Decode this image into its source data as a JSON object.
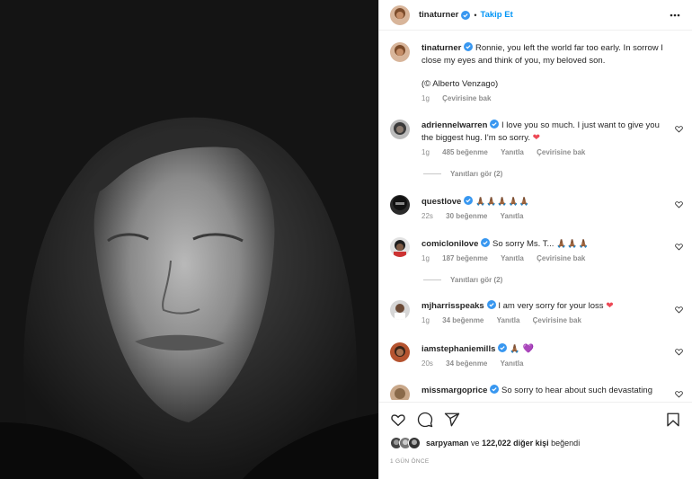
{
  "post": {
    "username": "tinaturner",
    "dot": "•",
    "follow_label": "Takip Et"
  },
  "caption": {
    "username": "tinaturner",
    "text": "Ronnie, you left the world far too early. In sorrow I close my eyes and think of you, my beloved son.",
    "credit": "(© Alberto Venzago)",
    "time": "1g",
    "translate": "Çevirisine bak"
  },
  "comments": [
    {
      "username": "adriennelwarren",
      "text": "I love you so much. I just want to give you the biggest hug. I'm so sorry.",
      "emoji": "❤",
      "time": "1g",
      "likes": "485 beğenme",
      "reply": "Yanıtla",
      "translate": "Çevirisine bak",
      "replies": "Yanıtları gör (2)"
    },
    {
      "username": "questlove",
      "text": "",
      "emoji": "🙏🏾🙏🏾🙏🏾🙏🏾🙏🏾",
      "time": "22s",
      "likes": "30 beğenme",
      "reply": "Yanıtla"
    },
    {
      "username": "comiclonilove",
      "text": "So sorry Ms. T...",
      "emoji": "🙏🏾🙏🏾🙏🏾",
      "time": "1g",
      "likes": "187 beğenme",
      "reply": "Yanıtla",
      "translate": "Çevirisine bak",
      "replies": "Yanıtları gör (2)"
    },
    {
      "username": "mjharrisspeaks",
      "text": "I am very sorry for your loss",
      "emoji": "❤",
      "time": "1g",
      "likes": "34 beğenme",
      "reply": "Yanıtla",
      "translate": "Çevirisine bak"
    },
    {
      "username": "iamstephaniemills",
      "text": "",
      "emoji": "🙏🏾",
      "emoji2": "💜",
      "time": "20s",
      "likes": "34 beğenme",
      "reply": "Yanıtla"
    },
    {
      "username": "missmargoprice",
      "text": "So sorry to hear about such devastating"
    }
  ],
  "likes_line": {
    "user": "sarpyaman",
    "conj": "ve",
    "others": "122,022 diğer kişi",
    "suffix": "beğendi"
  },
  "date": "1 GÜN ÖNCE",
  "icons": {
    "header_more": "more-horizontal-icon",
    "like": "heart-icon",
    "comment": "comment-icon",
    "share": "share-icon",
    "save": "bookmark-icon",
    "verified": "verified-badge-icon",
    "comment_like": "small-heart-icon"
  },
  "colors": {
    "accent": "#0095f6",
    "verified": "#3897f0",
    "heart": "#ed4956",
    "muted": "#8e8e8e"
  }
}
